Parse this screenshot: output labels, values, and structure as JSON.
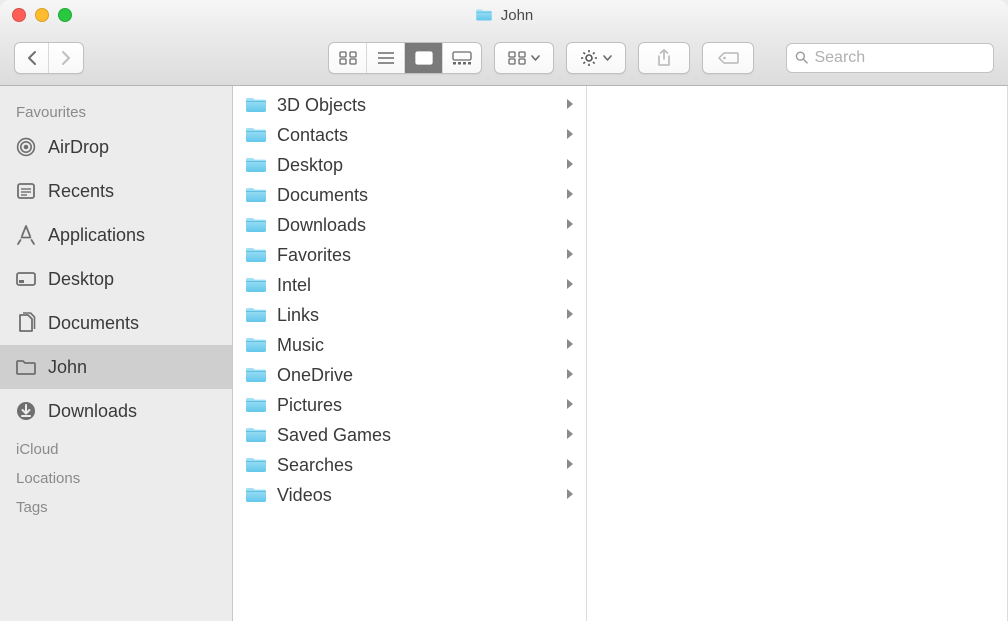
{
  "window": {
    "title": "John"
  },
  "search": {
    "placeholder": "Search"
  },
  "sidebar": {
    "sections": [
      {
        "heading": "Favourites",
        "items": [
          {
            "icon": "airdrop",
            "label": "AirDrop",
            "selected": false
          },
          {
            "icon": "recents",
            "label": "Recents",
            "selected": false
          },
          {
            "icon": "applications",
            "label": "Applications",
            "selected": false
          },
          {
            "icon": "desktop",
            "label": "Desktop",
            "selected": false
          },
          {
            "icon": "documents",
            "label": "Documents",
            "selected": false
          },
          {
            "icon": "folder",
            "label": "John",
            "selected": true
          },
          {
            "icon": "downloads",
            "label": "Downloads",
            "selected": false
          }
        ]
      },
      {
        "heading": "iCloud",
        "items": []
      },
      {
        "heading": "Locations",
        "items": []
      },
      {
        "heading": "Tags",
        "items": []
      }
    ]
  },
  "column": {
    "items": [
      {
        "label": "3D Objects",
        "hasChildren": true
      },
      {
        "label": "Contacts",
        "hasChildren": true
      },
      {
        "label": "Desktop",
        "hasChildren": true
      },
      {
        "label": "Documents",
        "hasChildren": true
      },
      {
        "label": "Downloads",
        "hasChildren": true
      },
      {
        "label": "Favorites",
        "hasChildren": true
      },
      {
        "label": "Intel",
        "hasChildren": true
      },
      {
        "label": "Links",
        "hasChildren": true
      },
      {
        "label": "Music",
        "hasChildren": true
      },
      {
        "label": "OneDrive",
        "hasChildren": true
      },
      {
        "label": "Pictures",
        "hasChildren": true
      },
      {
        "label": "Saved Games",
        "hasChildren": true
      },
      {
        "label": "Searches",
        "hasChildren": true
      },
      {
        "label": "Videos",
        "hasChildren": true
      }
    ]
  },
  "colors": {
    "folderLight": "#8fd7f2",
    "folderDark": "#5fc4e7"
  }
}
